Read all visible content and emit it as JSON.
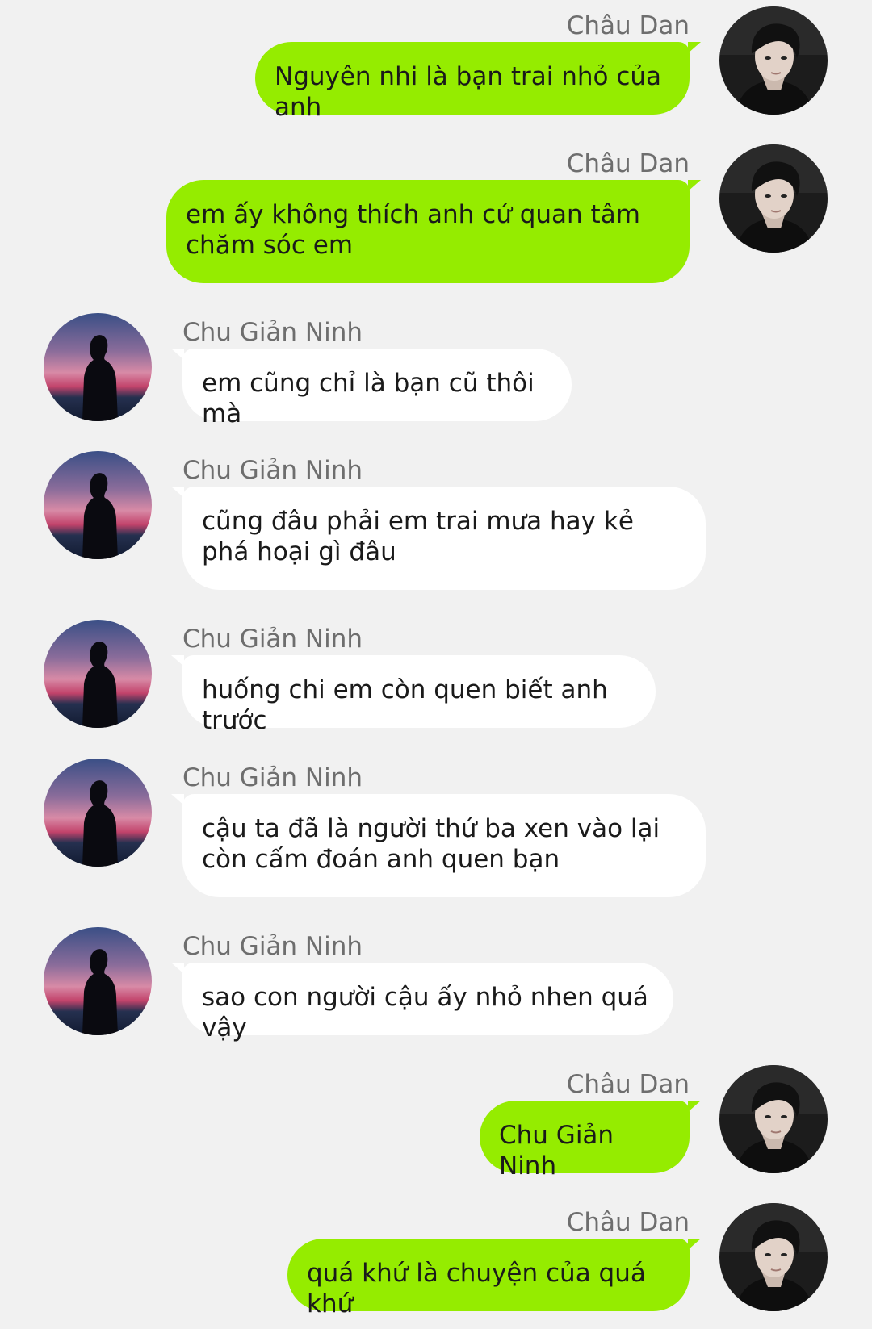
{
  "conversation": {
    "messages": [
      {
        "side": "right",
        "sender": "Châu Dan",
        "text": "Nguyên nhi là bạn trai nhỏ của anh",
        "avatar": "boy-portrait-avatar"
      },
      {
        "side": "right",
        "sender": "Châu Dan",
        "text": "em ấy không thích anh cứ quan tâm chăm sóc em",
        "avatar": "boy-portrait-avatar"
      },
      {
        "side": "left",
        "sender": "Chu Giản Ninh",
        "text": "em cũng chỉ là bạn cũ thôi mà",
        "avatar": "sunset-silhouette-avatar"
      },
      {
        "side": "left",
        "sender": "Chu Giản Ninh",
        "text": "cũng đâu phải em trai mưa hay kẻ phá hoại gì đâu",
        "avatar": "sunset-silhouette-avatar"
      },
      {
        "side": "left",
        "sender": "Chu Giản Ninh",
        "text": "huống chi em còn quen biết anh trước",
        "avatar": "sunset-silhouette-avatar"
      },
      {
        "side": "left",
        "sender": "Chu Giản Ninh",
        "text": "cậu ta đã là người thứ ba xen vào lại còn cấm đoán anh quen bạn",
        "avatar": "sunset-silhouette-avatar"
      },
      {
        "side": "left",
        "sender": "Chu Giản Ninh",
        "text": "sao con người cậu ấy nhỏ nhen quá vậy",
        "avatar": "sunset-silhouette-avatar"
      },
      {
        "side": "right",
        "sender": "Châu Dan",
        "text": "Chu Giản Ninh",
        "avatar": "boy-portrait-avatar"
      },
      {
        "side": "right",
        "sender": "Châu Dan",
        "text": "quá khứ là chuyện của quá khứ",
        "avatar": "boy-portrait-avatar"
      }
    ]
  },
  "colors": {
    "background": "#f1f1f1",
    "outgoing_bubble": "#95ec00",
    "incoming_bubble": "#ffffff",
    "sender_name": "#6e6e6e",
    "message_text": "#1a1a1a"
  }
}
